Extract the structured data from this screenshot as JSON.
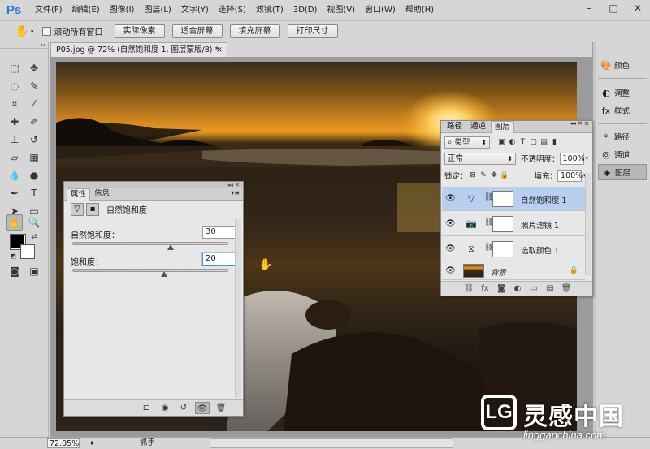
{
  "app": {
    "logo": "Ps",
    "menus": [
      "文件(F)",
      "编辑(E)",
      "图像(I)",
      "图层(L)",
      "文字(Y)",
      "选择(S)",
      "滤镜(T)",
      "3D(D)",
      "视图(V)",
      "窗口(W)",
      "帮助(H)"
    ],
    "window_controls": {
      "minimize": "–",
      "maximize": "□",
      "close": "✕"
    }
  },
  "options_bar": {
    "scroll_all_label": "滚动所有窗口",
    "scroll_all_checked": false,
    "buttons": [
      "实际像素",
      "适合屏幕",
      "填充屏幕",
      "打印尺寸"
    ]
  },
  "document": {
    "tab_title": "P05.jpg @ 72% (自然饱和度 1, 图层蒙版/8) *",
    "tab_close": "×"
  },
  "dock": {
    "items": [
      {
        "icon": "palette-icon",
        "label": "颜色",
        "active": false
      },
      {
        "icon": "adjustments-icon",
        "label": "调整",
        "active": false
      },
      {
        "icon": "styles-icon",
        "label": "样式",
        "active": false
      },
      {
        "icon": "paths-icon",
        "label": "路径",
        "active": false
      },
      {
        "icon": "channels-icon",
        "label": "通道",
        "active": false
      },
      {
        "icon": "layers-icon",
        "label": "图层",
        "active": true
      }
    ]
  },
  "properties": {
    "tabs": [
      {
        "label": "属性",
        "active": true
      },
      {
        "label": "信息",
        "active": false
      }
    ],
    "title": "自然饱和度",
    "sliders": [
      {
        "label": "自然饱和度：",
        "value": "30",
        "fraction": 0.62
      },
      {
        "label": "饱和度：",
        "value": "20",
        "fraction": 0.58
      }
    ]
  },
  "layers": {
    "tabs": [
      {
        "label": "路径",
        "active": false
      },
      {
        "label": "通道",
        "active": false
      },
      {
        "label": "图层",
        "active": true
      }
    ],
    "filter_kind": "类型",
    "blend_mode": "正常",
    "opacity_label": "不透明度：",
    "opacity_value": "100%",
    "lock_label": "锁定：",
    "fill_label": "填充：",
    "fill_value": "100%",
    "rows": [
      {
        "name": "自然饱和度 1",
        "icon": "vibrance-icon",
        "selected": true
      },
      {
        "name": "照片滤镜 1",
        "icon": "photo-filter-icon",
        "selected": false
      },
      {
        "name": "选取颜色 1",
        "icon": "selective-color-icon",
        "selected": false
      },
      {
        "name": "背景",
        "icon": "background-thumbnail",
        "selected": false
      }
    ]
  },
  "status": {
    "zoom": "72.05%",
    "tool": "抓手"
  },
  "watermark": {
    "logo_letter": "LG",
    "title": "灵感中国",
    "url": "lingganchina.com"
  },
  "colors": {
    "accent": "#2b7bd2",
    "layer_selected": "#b8cff0",
    "foreground": "#000000",
    "background": "#ffffff"
  }
}
